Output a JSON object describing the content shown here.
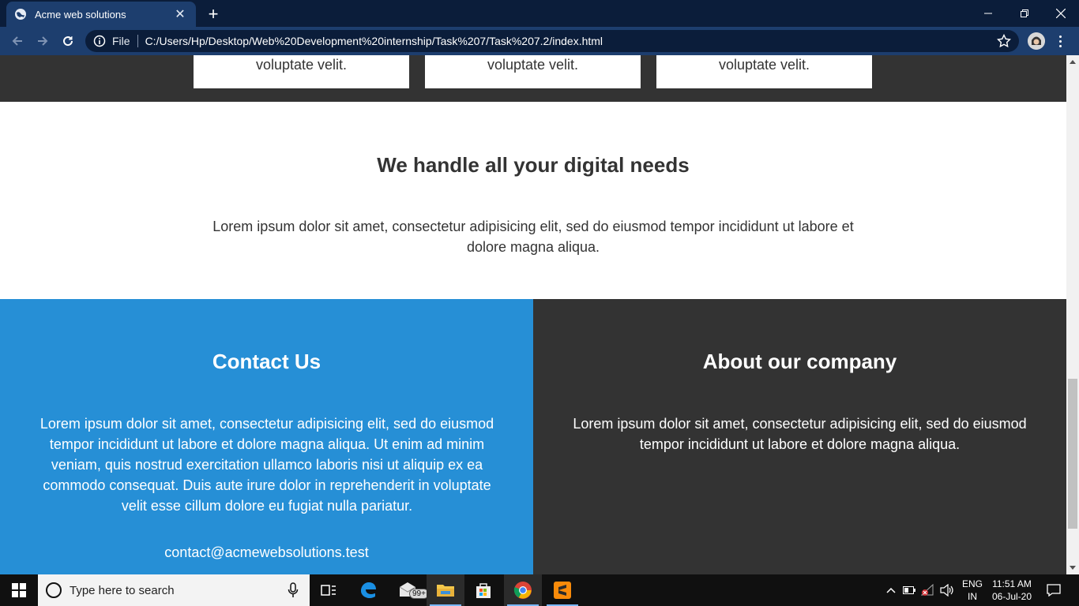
{
  "browser": {
    "tab_title": "Acme web solutions",
    "new_tab_label": "+",
    "omnibox_scheme": "File",
    "url": "C:/Users/Hp/Desktop/Web%20Development%20internship/Task%207/Task%207.2/index.html"
  },
  "page": {
    "cards": [
      {
        "text": "voluptate velit."
      },
      {
        "text": "voluptate velit."
      },
      {
        "text": "voluptate velit."
      }
    ],
    "needs": {
      "title": "We handle all your digital needs",
      "text": "Lorem ipsum dolor sit amet, consectetur adipisicing elit, sed do eiusmod tempor incididunt ut labore et dolore magna aliqua."
    },
    "contact": {
      "title": "Contact Us",
      "text": "Lorem ipsum dolor sit amet, consectetur adipisicing elit, sed do eiusmod tempor incididunt ut labore et dolore magna aliqua. Ut enim ad minim veniam, quis nostrud exercitation ullamco laboris nisi ut aliquip ex ea commodo consequat. Duis aute irure dolor in reprehenderit in voluptate velit esse cillum dolore eu fugiat nulla pariatur.",
      "email": "contact@acmewebsolutions.test"
    },
    "about": {
      "title": "About our company",
      "text": "Lorem ipsum dolor sit amet, consectetur adipisicing elit, sed do eiusmod tempor incididunt ut labore et dolore magna aliqua."
    }
  },
  "taskbar": {
    "search_placeholder": "Type here to search",
    "mail_badge": "99+",
    "lang_primary": "ENG",
    "lang_region": "IN",
    "time": "11:51 AM",
    "date": "06-Jul-20"
  },
  "colors": {
    "contact_bg": "#268fd6",
    "dark_bg": "#333333",
    "browser_frame": "#0b1d3a",
    "browser_toolbar": "#1d3e6e"
  }
}
